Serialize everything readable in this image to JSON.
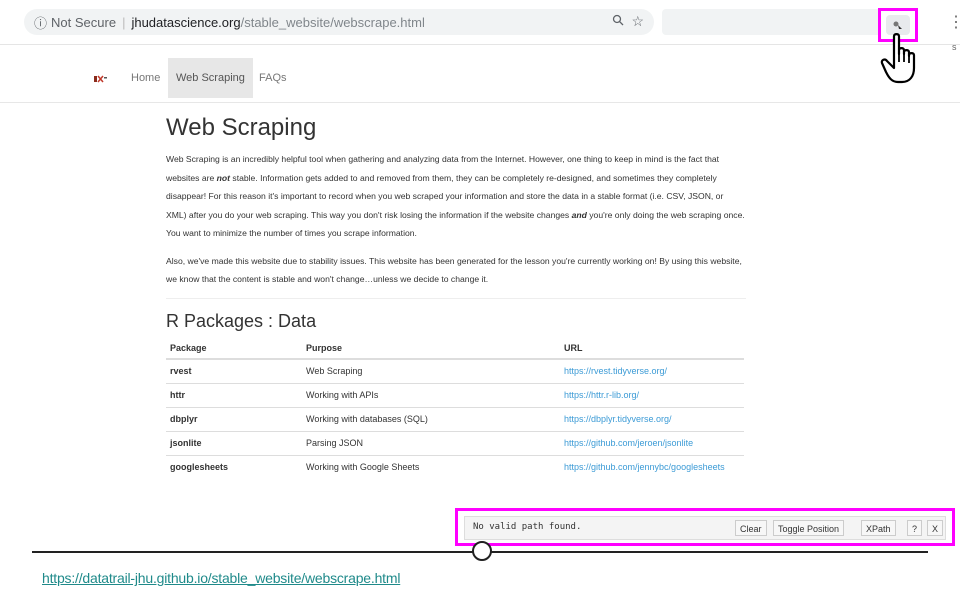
{
  "browser": {
    "security_label": "Not Secure",
    "url_host": "jhudatascience.org",
    "url_path": "/stable_website/webscrape.html",
    "zoom_icon": "zoom-icon",
    "star_icon": "star-icon",
    "extension_icon": "xpath-extension-icon",
    "menu_icon": "kebab-menu-icon",
    "side_letter": "s"
  },
  "nav": {
    "items": [
      {
        "label": "Home",
        "active": false
      },
      {
        "label": "Web Scraping",
        "active": true
      },
      {
        "label": "FAQs",
        "active": false
      }
    ]
  },
  "article": {
    "title": "Web Scraping",
    "p1_a": "Web Scraping is an incredibly helpful tool when gathering and analyzing data from the Internet. However, one thing to keep in mind is the fact that websites are ",
    "p1_b": "not",
    "p1_c": " stable. Information gets added to and removed from them, they can be completely re-designed, and sometimes they completely disappear! For this reason it's important to record when you web scraped your information and store the data in a stable format (i.e. CSV, JSON, or XML) after you do your web scraping. This way you don't risk losing the information if the website changes ",
    "p1_d": "and",
    "p1_e": " you're only doing the web scraping once. You want to minimize the number of times you scrape information.",
    "p2": "Also, we've made this website due to stability issues. This website has been generated for the lesson you're currently working on! By using this website, we know that the content is stable and won't change…unless we decide to change it.",
    "section_title": "R Packages : Data",
    "table": {
      "headers": [
        "Package",
        "Purpose",
        "URL"
      ],
      "rows": [
        [
          "rvest",
          "Web Scraping",
          "https://rvest.tidyverse.org/"
        ],
        [
          "httr",
          "Working with APIs",
          "https://httr.r-lib.org/"
        ],
        [
          "dbplyr",
          "Working with databases (SQL)",
          "https://dbplyr.tidyverse.org/"
        ],
        [
          "jsonlite",
          "Parsing JSON",
          "https://github.com/jeroen/jsonlite"
        ],
        [
          "googlesheets",
          "Working with Google Sheets",
          "https://github.com/jennybc/googlesheets"
        ]
      ]
    }
  },
  "helper": {
    "message": "No valid path found.",
    "clear": "Clear",
    "toggle": "Toggle Position",
    "xpath": "XPath",
    "help": "?",
    "close": "X"
  },
  "footer_link": "https://datatrail-jhu.github.io/stable_website/webscrape.html",
  "colors": {
    "highlight": "#ff00ff",
    "link": "#3c9bd6",
    "footer_link": "#1f8a8a"
  }
}
